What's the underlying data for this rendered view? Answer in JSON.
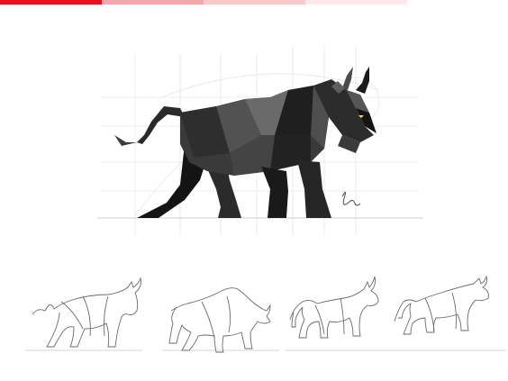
{
  "header": {
    "progress_segments": [
      "#e8101c",
      "#f5a6aa",
      "#f9c9cc",
      "#fde8e9"
    ]
  },
  "colors": {
    "background": "#ffffff",
    "bull_dark": "#1e1e1e",
    "bull_mid": "#4a4a4a",
    "bull_light": "#8a8a8a",
    "grid": "#e4e4e4",
    "sketch_stroke": "#6a6a6a"
  },
  "icons": {
    "main_artwork": "low-poly-bull-icon",
    "signature": "artist-signature",
    "sketches": [
      "bull-sketch-icon",
      "bull-sketch-icon",
      "bull-sketch-icon",
      "bull-sketch-icon"
    ]
  }
}
